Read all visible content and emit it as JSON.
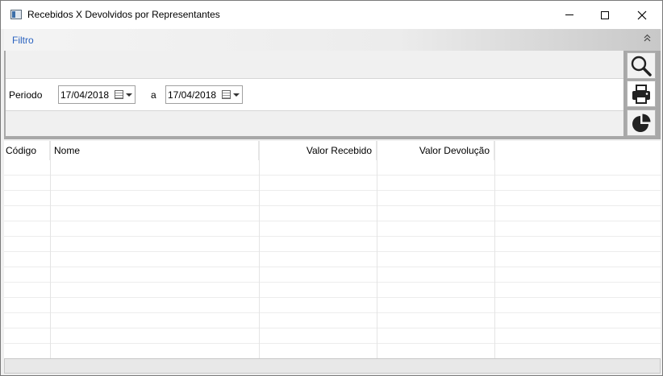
{
  "window": {
    "title": "Recebidos X Devolvidos por Representantes"
  },
  "filter": {
    "title": "Filtro",
    "period_label": "Periodo",
    "date_from": "17/04/2018",
    "separator": "a",
    "date_to": "17/04/2018"
  },
  "toolbar": {
    "search_icon": "magnifier-icon",
    "print_icon": "printer-icon",
    "chart_icon": "pie-chart-icon"
  },
  "grid": {
    "columns": [
      "Código",
      "Nome",
      "Valor Recebido",
      "Valor Devolução"
    ],
    "rows": []
  }
}
